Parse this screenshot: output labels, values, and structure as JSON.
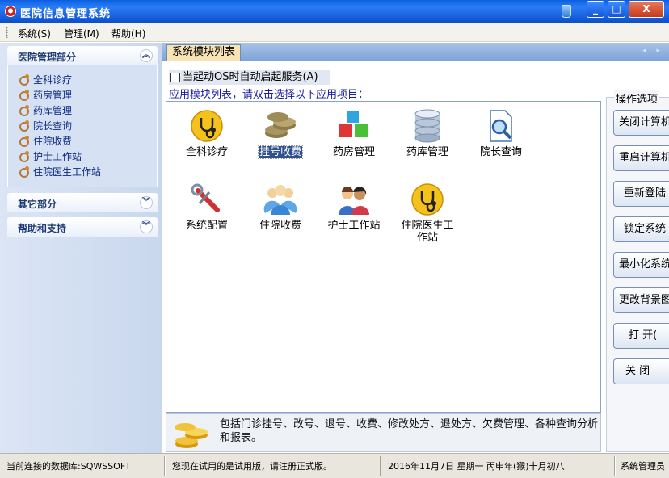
{
  "window": {
    "title": "医院信息管理系统",
    "min": "_",
    "max": "□",
    "close": "X"
  },
  "menu": [
    {
      "label": "系统(S)"
    },
    {
      "label": "管理(M)"
    },
    {
      "label": "帮助(H)"
    }
  ],
  "sidebar": {
    "sections": [
      {
        "label": "医院管理部分",
        "state": "expanded"
      },
      {
        "label": "其它部分",
        "state": "collapsed"
      },
      {
        "label": "帮助和支持",
        "state": "collapsed"
      }
    ],
    "items": [
      {
        "label": "全科诊疗"
      },
      {
        "label": "药房管理"
      },
      {
        "label": "药库管理"
      },
      {
        "label": "院长查询"
      },
      {
        "label": "住院收费"
      },
      {
        "label": "护士工作站"
      },
      {
        "label": "住院医生工作站"
      }
    ],
    "chev_up": "︽",
    "chev_down": "︾"
  },
  "main": {
    "tab": "系统模块列表",
    "tabnav": "◂ ▸",
    "autostart_label": "当起动OS时自动启起服务(A)",
    "autostart_checked": false,
    "hint": "应用模块列表，请双击选择以下应用项目：",
    "modules": [
      {
        "label": "全科诊疗",
        "icon": "stethoscope-icon",
        "selected": false
      },
      {
        "label": "挂号收费",
        "icon": "coins-icon",
        "selected": true
      },
      {
        "label": "药房管理",
        "icon": "cubes-icon",
        "selected": false
      },
      {
        "label": "药库管理",
        "icon": "database-icon",
        "selected": false
      },
      {
        "label": "院长查询",
        "icon": "search-document-icon",
        "selected": false
      },
      {
        "label": "系统配置",
        "icon": "wrench-icon",
        "selected": false
      },
      {
        "label": "住院收费",
        "icon": "users-icon",
        "selected": false
      },
      {
        "label": "护士工作站",
        "icon": "people-icon",
        "selected": false
      },
      {
        "label": "住院医生工作站",
        "icon": "stethoscope-icon",
        "selected": false
      }
    ],
    "description": "包括门诊挂号、改号、退号、收费、修改处方、退处方、欠费管理、各种查询分析和报表。"
  },
  "options": {
    "label": "操作选项",
    "buttons": [
      {
        "label": "关闭计算机"
      },
      {
        "label": "重启计算机"
      },
      {
        "label": "重新登陆"
      },
      {
        "label": "锁定系统"
      },
      {
        "label": "最小化系统"
      },
      {
        "label": "更改背景图"
      },
      {
        "label": "打  开("
      },
      {
        "label": "关  闭"
      }
    ]
  },
  "status": {
    "database": "当前连接的数据库:SQWSSOFT",
    "trial": "您现在试用的是试用版，请注册正式版。",
    "date": "2016年11月7日  星期一   丙申年(猴)十月初八",
    "system": "系统管理员"
  },
  "colors": {
    "titlebar": "#1a63df",
    "sidebar_header_text": "#1d3a74",
    "selected_bg": "#2f4f8f",
    "tab_bg": "#f7e3b3"
  }
}
